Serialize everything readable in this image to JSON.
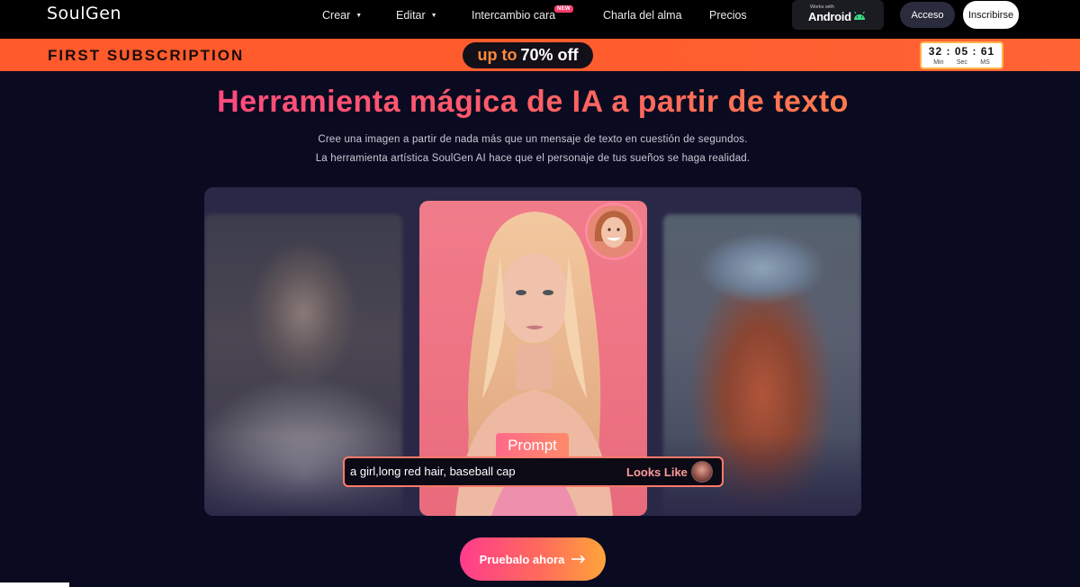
{
  "nav": {
    "logo": "SoulGen",
    "items": [
      {
        "label": "Crear",
        "dropdown": true
      },
      {
        "label": "Editar",
        "dropdown": true
      },
      {
        "label": "Intercambio cara",
        "badge": "NEW"
      },
      {
        "label": "Charla del alma"
      },
      {
        "label": "Precios"
      }
    ],
    "android": {
      "small": "Works with",
      "label": "Android"
    },
    "login": "Acceso",
    "signup": "Inscribirse"
  },
  "promo": {
    "label": "FIRST SUBSCRIPTION",
    "up_to": "up to",
    "discount": "70% off",
    "timer": {
      "min": "32",
      "sec": "05",
      "ms": "61",
      "min_label": "Min",
      "sec_label": "Sec",
      "ms_label": "MS"
    }
  },
  "hero": {
    "title": "Herramienta mágica de IA a partir de texto",
    "subtitle_1": "Cree una imagen a partir de nada más que un mensaje de texto en cuestión de segundos.",
    "subtitle_2": "La herramienta artística SoulGen AI hace que el personaje de tus sueños se haga realidad."
  },
  "prompt": {
    "tag": "Prompt",
    "text": "a girl,long red hair, baseball cap",
    "looks_like": "Looks Like"
  },
  "cta": {
    "label": "Pruebalo ahora"
  },
  "colors": {
    "background": "#0a0b21",
    "promo_orange": "#ff5a2c",
    "accent_pink": "#ff3d8c",
    "accent_orange": "#ffa43a"
  }
}
